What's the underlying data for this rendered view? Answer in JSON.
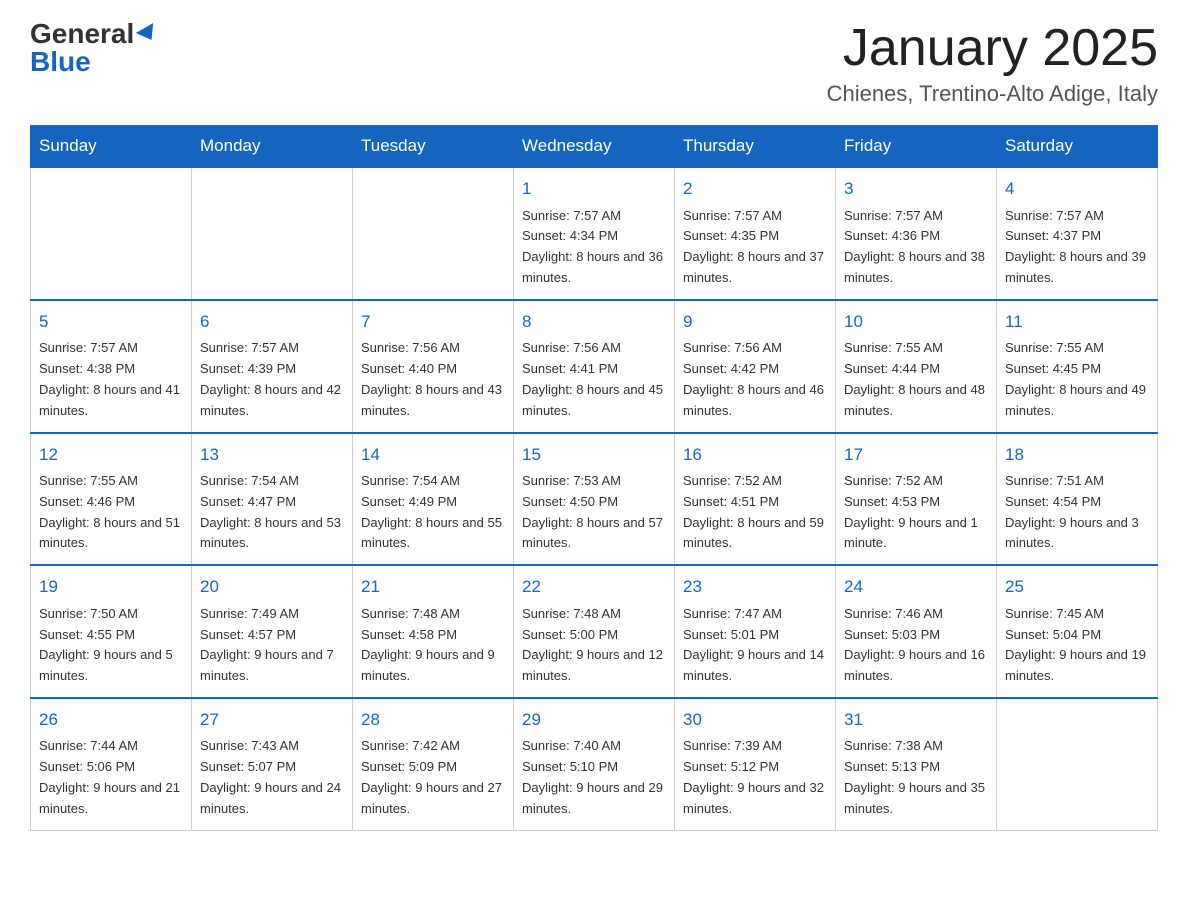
{
  "header": {
    "logo_general": "General",
    "logo_blue": "Blue",
    "main_title": "January 2025",
    "subtitle": "Chienes, Trentino-Alto Adige, Italy"
  },
  "days_of_week": [
    "Sunday",
    "Monday",
    "Tuesday",
    "Wednesday",
    "Thursday",
    "Friday",
    "Saturday"
  ],
  "weeks": [
    [
      {
        "day": "",
        "info": ""
      },
      {
        "day": "",
        "info": ""
      },
      {
        "day": "",
        "info": ""
      },
      {
        "day": "1",
        "info": "Sunrise: 7:57 AM\nSunset: 4:34 PM\nDaylight: 8 hours\nand 36 minutes."
      },
      {
        "day": "2",
        "info": "Sunrise: 7:57 AM\nSunset: 4:35 PM\nDaylight: 8 hours\nand 37 minutes."
      },
      {
        "day": "3",
        "info": "Sunrise: 7:57 AM\nSunset: 4:36 PM\nDaylight: 8 hours\nand 38 minutes."
      },
      {
        "day": "4",
        "info": "Sunrise: 7:57 AM\nSunset: 4:37 PM\nDaylight: 8 hours\nand 39 minutes."
      }
    ],
    [
      {
        "day": "5",
        "info": "Sunrise: 7:57 AM\nSunset: 4:38 PM\nDaylight: 8 hours\nand 41 minutes."
      },
      {
        "day": "6",
        "info": "Sunrise: 7:57 AM\nSunset: 4:39 PM\nDaylight: 8 hours\nand 42 minutes."
      },
      {
        "day": "7",
        "info": "Sunrise: 7:56 AM\nSunset: 4:40 PM\nDaylight: 8 hours\nand 43 minutes."
      },
      {
        "day": "8",
        "info": "Sunrise: 7:56 AM\nSunset: 4:41 PM\nDaylight: 8 hours\nand 45 minutes."
      },
      {
        "day": "9",
        "info": "Sunrise: 7:56 AM\nSunset: 4:42 PM\nDaylight: 8 hours\nand 46 minutes."
      },
      {
        "day": "10",
        "info": "Sunrise: 7:55 AM\nSunset: 4:44 PM\nDaylight: 8 hours\nand 48 minutes."
      },
      {
        "day": "11",
        "info": "Sunrise: 7:55 AM\nSunset: 4:45 PM\nDaylight: 8 hours\nand 49 minutes."
      }
    ],
    [
      {
        "day": "12",
        "info": "Sunrise: 7:55 AM\nSunset: 4:46 PM\nDaylight: 8 hours\nand 51 minutes."
      },
      {
        "day": "13",
        "info": "Sunrise: 7:54 AM\nSunset: 4:47 PM\nDaylight: 8 hours\nand 53 minutes."
      },
      {
        "day": "14",
        "info": "Sunrise: 7:54 AM\nSunset: 4:49 PM\nDaylight: 8 hours\nand 55 minutes."
      },
      {
        "day": "15",
        "info": "Sunrise: 7:53 AM\nSunset: 4:50 PM\nDaylight: 8 hours\nand 57 minutes."
      },
      {
        "day": "16",
        "info": "Sunrise: 7:52 AM\nSunset: 4:51 PM\nDaylight: 8 hours\nand 59 minutes."
      },
      {
        "day": "17",
        "info": "Sunrise: 7:52 AM\nSunset: 4:53 PM\nDaylight: 9 hours\nand 1 minute."
      },
      {
        "day": "18",
        "info": "Sunrise: 7:51 AM\nSunset: 4:54 PM\nDaylight: 9 hours\nand 3 minutes."
      }
    ],
    [
      {
        "day": "19",
        "info": "Sunrise: 7:50 AM\nSunset: 4:55 PM\nDaylight: 9 hours\nand 5 minutes."
      },
      {
        "day": "20",
        "info": "Sunrise: 7:49 AM\nSunset: 4:57 PM\nDaylight: 9 hours\nand 7 minutes."
      },
      {
        "day": "21",
        "info": "Sunrise: 7:48 AM\nSunset: 4:58 PM\nDaylight: 9 hours\nand 9 minutes."
      },
      {
        "day": "22",
        "info": "Sunrise: 7:48 AM\nSunset: 5:00 PM\nDaylight: 9 hours\nand 12 minutes."
      },
      {
        "day": "23",
        "info": "Sunrise: 7:47 AM\nSunset: 5:01 PM\nDaylight: 9 hours\nand 14 minutes."
      },
      {
        "day": "24",
        "info": "Sunrise: 7:46 AM\nSunset: 5:03 PM\nDaylight: 9 hours\nand 16 minutes."
      },
      {
        "day": "25",
        "info": "Sunrise: 7:45 AM\nSunset: 5:04 PM\nDaylight: 9 hours\nand 19 minutes."
      }
    ],
    [
      {
        "day": "26",
        "info": "Sunrise: 7:44 AM\nSunset: 5:06 PM\nDaylight: 9 hours\nand 21 minutes."
      },
      {
        "day": "27",
        "info": "Sunrise: 7:43 AM\nSunset: 5:07 PM\nDaylight: 9 hours\nand 24 minutes."
      },
      {
        "day": "28",
        "info": "Sunrise: 7:42 AM\nSunset: 5:09 PM\nDaylight: 9 hours\nand 27 minutes."
      },
      {
        "day": "29",
        "info": "Sunrise: 7:40 AM\nSunset: 5:10 PM\nDaylight: 9 hours\nand 29 minutes."
      },
      {
        "day": "30",
        "info": "Sunrise: 7:39 AM\nSunset: 5:12 PM\nDaylight: 9 hours\nand 32 minutes."
      },
      {
        "day": "31",
        "info": "Sunrise: 7:38 AM\nSunset: 5:13 PM\nDaylight: 9 hours\nand 35 minutes."
      },
      {
        "day": "",
        "info": ""
      }
    ]
  ]
}
